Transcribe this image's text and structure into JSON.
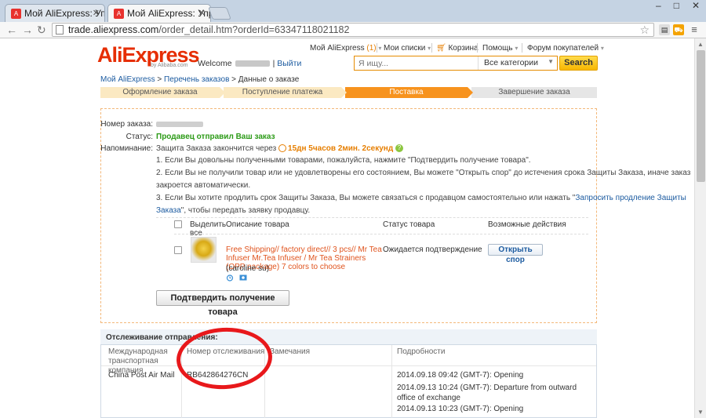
{
  "browser": {
    "tabs": [
      {
        "title": "Мой AliExpress: Упр"
      },
      {
        "title": "Мой AliExpress: Упр"
      }
    ],
    "url_host": "trade.aliexpress.com",
    "url_path": "/order_detail.htm?orderId=63347118021182"
  },
  "header": {
    "logo": "AliExpress",
    "logo_sub": "by Alibaba.com",
    "welcome": "Welcome",
    "logout": "Выйти",
    "top_links": {
      "my_ali": "Мой AliExpress",
      "my_ali_count": "(1)",
      "my_lists": "Мои списки",
      "cart": "Корзина",
      "help": "Помощь",
      "forum": "Форум покупателей"
    },
    "search_placeholder": "Я ищу...",
    "category": "Все категории",
    "search_btn": "Search"
  },
  "breadcrumb": {
    "home": "Мой AliExpress",
    "orders": "Перечень заказов",
    "current": "Данные о заказе"
  },
  "steps": [
    {
      "label": "Оформление заказа",
      "state": "done"
    },
    {
      "label": "Поступление платежа",
      "state": "done"
    },
    {
      "label": "Поставка",
      "state": "current"
    },
    {
      "label": "Завершение заказа",
      "state": "todo"
    }
  ],
  "order": {
    "number_label": "Номер заказа:",
    "status_label": "Статус:",
    "status_value": "Продавец отправил Ваш заказ",
    "reminder_label": "Напоминание:",
    "reminder_text": "Защита Заказа закончится через",
    "countdown": "15дн 5часов 2мин. 2секунд",
    "note1": "1. Если Вы довольны полученными товарами, пожалуйста, нажмите \"Подтвердить получение товара\".",
    "note2a": "2. Если Вы не получили товар или не удовлетворены его состоянием, Вы можете \"Открыть спор\" до истечения срока Защиты Заказа, иначе заказ",
    "note2b": "закроется автоматически.",
    "note3a": "3. Если Вы хотите продлить срок Защиты Заказа, Вы можете связаться с продавцом самостоятельно или нажать \"",
    "note3_link": "Запросить продление Защиты",
    "note3_link2": "Заказа",
    "note3b": "\", чтобы передать заявку продавцу.",
    "confirm_btn": "Подтвердить получение товара"
  },
  "products_table": {
    "headers": {
      "select_all": "Выделить все",
      "description": "Описание товара",
      "status": "Статус товара",
      "actions": "Возможные действия"
    },
    "rows": [
      {
        "title": "Free Shipping// factory direct// 3 pcs// Mr Tea Infuser Mr.Tea Infuser / Mr Tea Strainers (OPP package) 7 colors to choose",
        "seller": "(caroline su)",
        "status": "Ожидается подтверждение",
        "action": "Открыть спор"
      }
    ]
  },
  "tracking": {
    "title": "Отслеживание отправления:",
    "headers": {
      "company": "Международная транспортная компания",
      "tracking_no": "Номер отслеживания",
      "remarks": "Замечания",
      "details": "Подробности"
    },
    "rows": [
      {
        "company": "China Post Air Mail",
        "tracking_no": "RB642864276CN",
        "events": [
          "2014.09.18 09:42 (GMT-7): Opening",
          "2014.09.13 10:24 (GMT-7): Departure from outward office of exchange",
          "2014.09.13 10:23 (GMT-7): Opening"
        ]
      }
    ]
  },
  "colors": {
    "brand": "#e62e04",
    "accent": "#f7931e",
    "link": "#1c5ba0",
    "status_green": "#2b9a16",
    "highlight_circle": "#e8181b"
  }
}
